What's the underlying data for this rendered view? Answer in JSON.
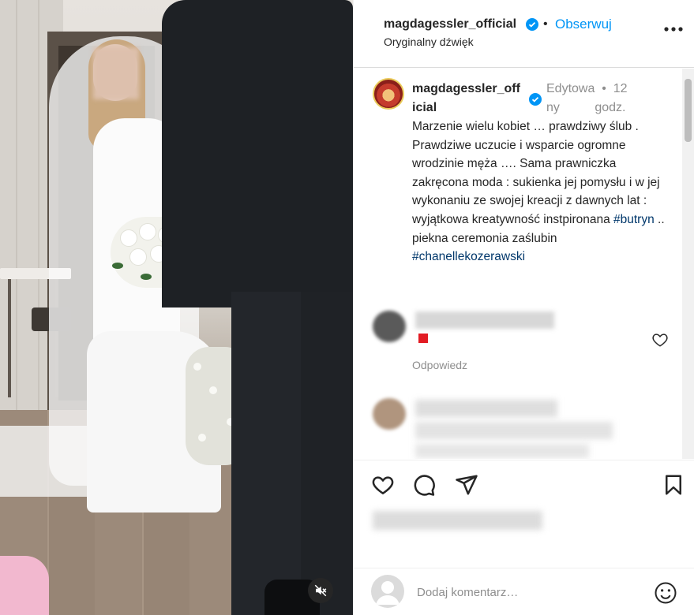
{
  "post": {
    "username": "magdagessler_official",
    "follow_label": "Obserwuj",
    "dot": "•",
    "audio": "Oryginalny dźwięk"
  },
  "caption": {
    "username_line1": "magdagessler_off",
    "username_line2": "icial",
    "edited_line1": "Edytowa  •  12",
    "edited_line2": "ny          godz.",
    "text_part1": "Marzenie wielu kobiet … prawdziwy ślub . Prawdziwe uczucie i wsparcie ogromne wrodzinie męża …. Sama prawniczka zakręcona moda : sukienka jej pomysłu i w jej wykonaniu ze swojej kreacji z dawnych lat : wyjątkowa kreatywność instpironana ",
    "hashtag1": "#butryn",
    "text_part2": " .. piekna ceremonia zaślubin ",
    "hashtag2": "#chanellekozerawski"
  },
  "comments": {
    "reply_label": "Odpowiedz"
  },
  "add_comment": {
    "placeholder": "Dodaj komentarz…"
  },
  "colors": {
    "accent": "#0095f6",
    "hashtag": "#00376b",
    "muted": "#8e8e8e",
    "text": "#262626"
  },
  "icons": [
    "verified-badge-icon",
    "more-options-icon",
    "heart-icon",
    "comment-icon",
    "share-icon",
    "bookmark-icon",
    "emoji-icon",
    "mute-icon",
    "default-avatar-icon"
  ]
}
